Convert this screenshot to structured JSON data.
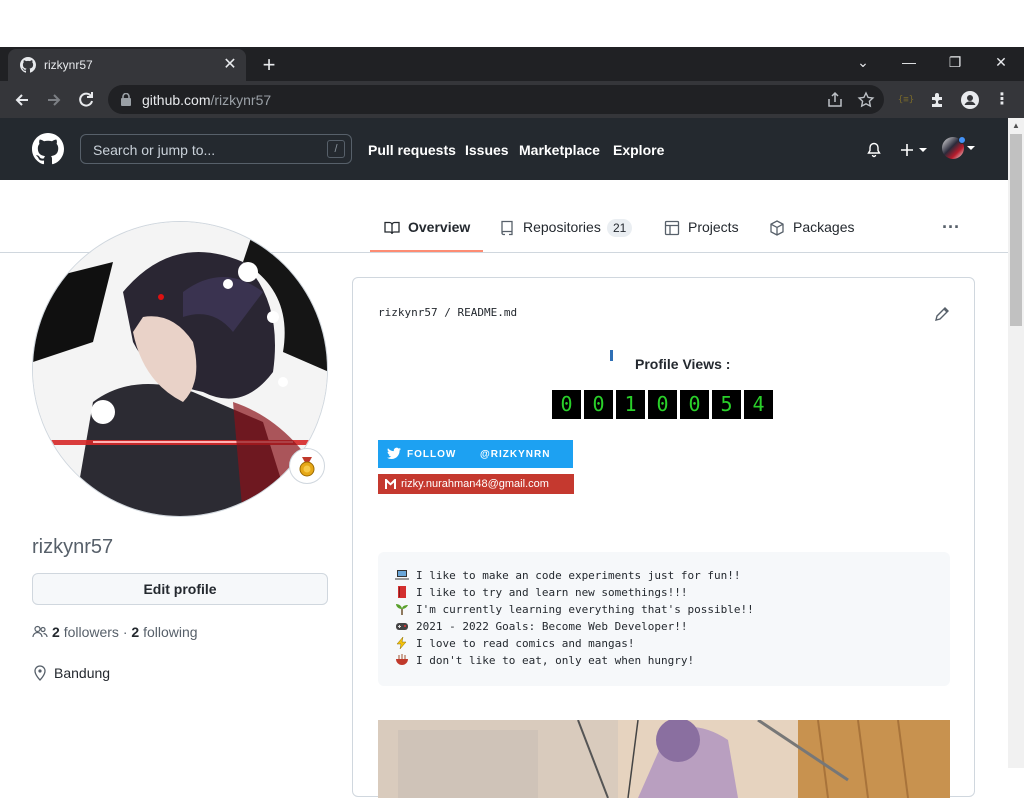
{
  "browser": {
    "tab_title": "rizkynr57",
    "url_host": "github.com",
    "url_path": "/rizkynr57"
  },
  "github": {
    "search_placeholder": "Search or jump to...",
    "search_shortcut": "/",
    "nav": [
      "Pull requests",
      "Issues",
      "Marketplace",
      "Explore"
    ]
  },
  "profile_tabs": {
    "overview": "Overview",
    "repositories": "Repositories",
    "repositories_count": "21",
    "projects": "Projects",
    "packages": "Packages"
  },
  "sidebar": {
    "username": "rizkynr57",
    "edit_profile": "Edit profile",
    "followers_count": "2",
    "followers_label": "followers",
    "separator": "·",
    "following_count": "2",
    "following_label": "following",
    "location": "Bandung"
  },
  "readme": {
    "path_user": "rizkynr57",
    "path_sep": "/",
    "path_file": "README.md",
    "views_label": "Profile Views :",
    "view_digits": [
      "0",
      "0",
      "1",
      "0",
      "0",
      "5",
      "4"
    ],
    "twitter_follow": "FOLLOW",
    "twitter_handle": "@RIZKYNRN",
    "email": "rizky.nurahman48@gmail.com",
    "lines": [
      "I like to make an code experiments just for fun!!",
      "I like to try and learn new somethings!!!",
      "I'm currently learning everything that's possible!!",
      "2021 - 2022 Goals: Become Web Developer!!",
      "I love to read comics and mangas!",
      "I don't like to eat, only eat when hungry!"
    ]
  },
  "colors": {
    "github_header": "#24292f",
    "tab_underline": "#fd8c73",
    "twitter_blue": "#1da1f2",
    "gmail_red": "#c5392f",
    "counter_green": "#2ad12a"
  }
}
